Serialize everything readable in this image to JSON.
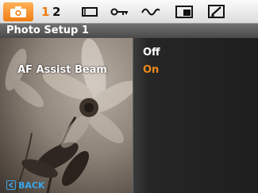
{
  "tabs": {
    "active_icon": "camera-icon",
    "pages": [
      "1",
      "2"
    ],
    "other_icons": [
      "aspect-ratio-icon",
      "key-icon",
      "curve-icon",
      "display-icon",
      "edit-icon"
    ]
  },
  "title": "Photo Setup 1",
  "setting": {
    "label": "AF Assist Beam",
    "options": [
      "Off",
      "On"
    ],
    "selected": "On"
  },
  "back": {
    "label": "BACK",
    "icon": "back-arrow-icon"
  },
  "colors": {
    "accent": "#f08a1c",
    "back_hint": "#39a6e8",
    "title_strip": "#5c5c5c"
  }
}
